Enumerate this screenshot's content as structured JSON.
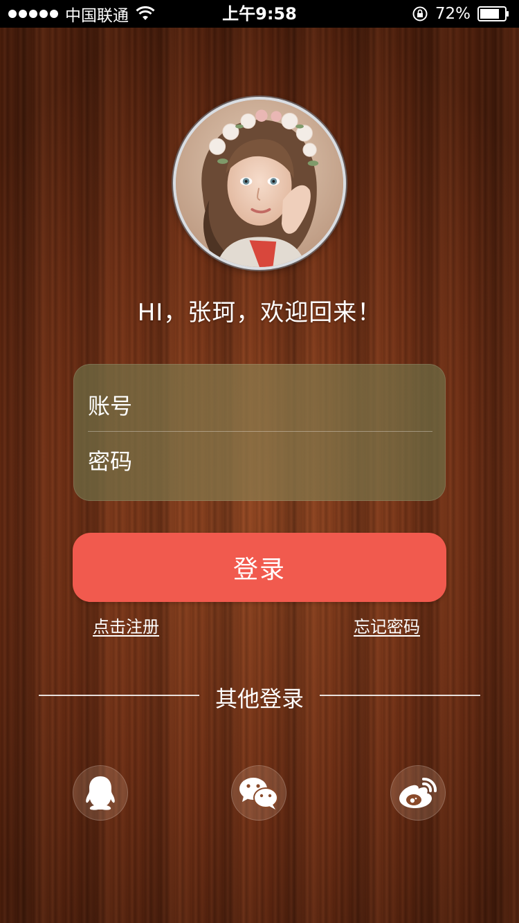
{
  "status_bar": {
    "carrier": "中国联通",
    "time": "上午9:58",
    "battery": "72%"
  },
  "avatar": {
    "icon": "user-avatar-photo"
  },
  "greeting": "HI，张珂，欢迎回来！",
  "form": {
    "account_placeholder": "账号",
    "password_placeholder": "密码"
  },
  "login_button": "登录",
  "links": {
    "register": "点击注册",
    "forgot_password": "忘记密码"
  },
  "other_login": {
    "title": "其他登录",
    "providers": [
      {
        "icon": "qq-icon"
      },
      {
        "icon": "wechat-icon"
      },
      {
        "icon": "weibo-icon"
      }
    ]
  },
  "colors": {
    "accent": "#f15a4e",
    "background": "#6e2f15"
  }
}
